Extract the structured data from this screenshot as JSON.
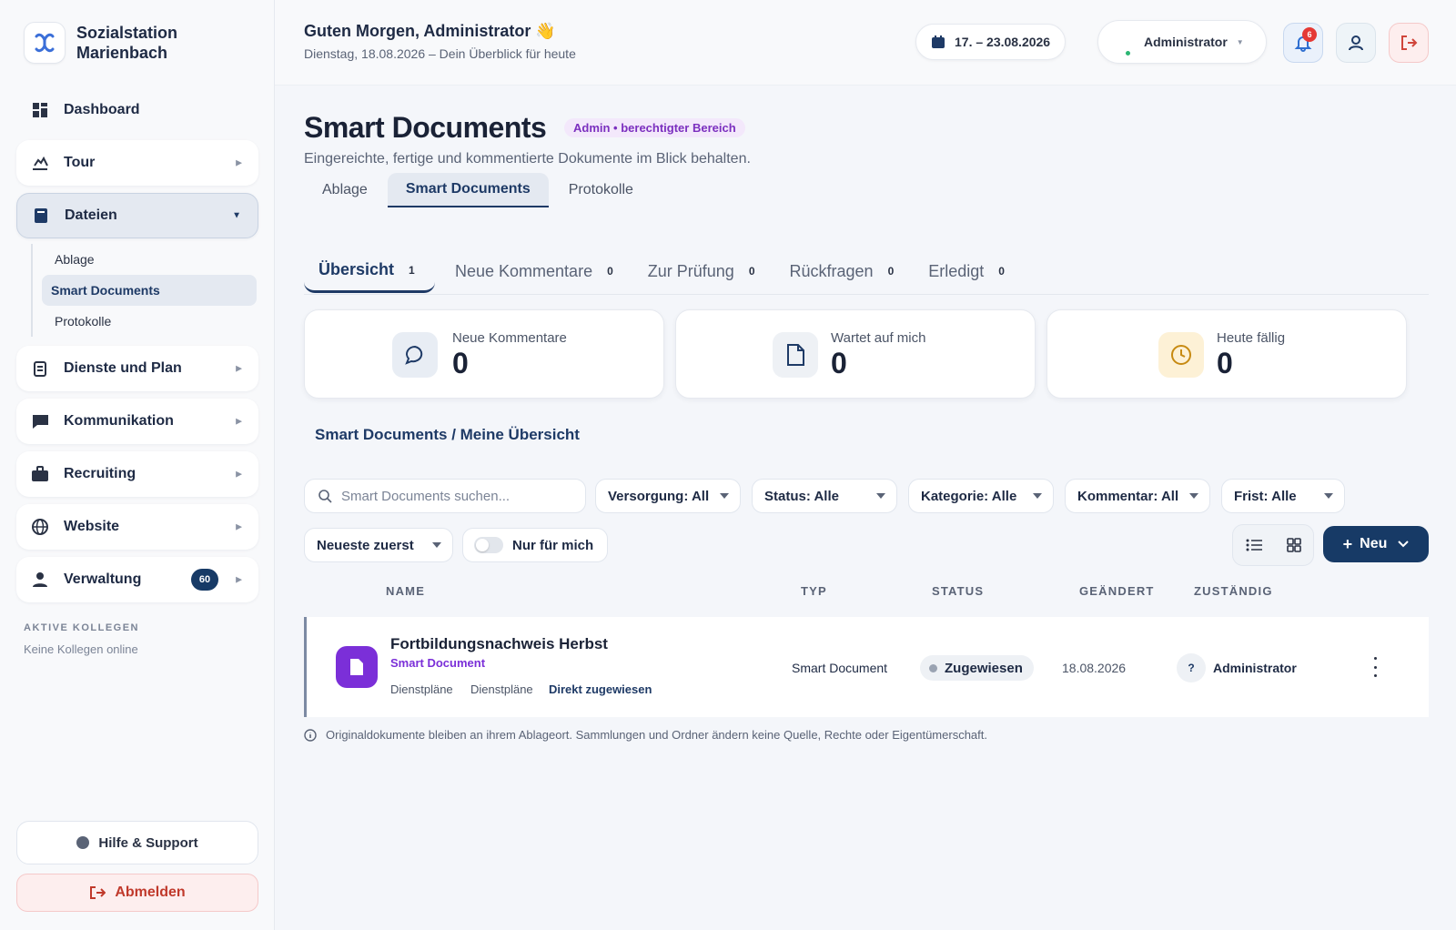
{
  "brand": {
    "line1": "Sozialstation",
    "line2": "Marienbach"
  },
  "sidebar": {
    "items": [
      {
        "label": "Dashboard",
        "icon": "dashboard-icon"
      },
      {
        "label": "Tour",
        "icon": "tour-icon"
      },
      {
        "label": "Dateien",
        "icon": "folder-icon"
      },
      {
        "label": "Dienste und Plan",
        "icon": "schedule-icon"
      },
      {
        "label": "Kommunikation",
        "icon": "chat-icon"
      },
      {
        "label": "Recruiting",
        "icon": "briefcase-icon"
      },
      {
        "label": "Website",
        "icon": "globe-icon"
      },
      {
        "label": "Verwaltung",
        "icon": "person-icon",
        "badge": "60"
      }
    ],
    "subitems": [
      "Ablage",
      "Smart Documents",
      "Protokolle"
    ],
    "colleagues_title": "AKTIVE KOLLEGEN",
    "colleagues_text": "Keine Kollegen online",
    "help": "Hilfe & Support",
    "logout": "Abmelden"
  },
  "header": {
    "greeting": "Guten Morgen, Administrator 👋",
    "subtitle": "Dienstag, 18.08.2026 – Dein Überblick für heute",
    "date_range": "17. – 23.08.2026",
    "user": "Administrator",
    "notifications": "6"
  },
  "page": {
    "title": "Smart Documents",
    "pill": "Admin • berechtigter Bereich",
    "subtitle": "Eingereichte, fertige und kommentierte Dokumente im Blick behalten.",
    "tabs": [
      "Ablage",
      "Smart Documents",
      "Protokolle"
    ]
  },
  "subtabs": [
    {
      "label": "Übersicht",
      "count": "1"
    },
    {
      "label": "Neue Kommentare",
      "count": "0"
    },
    {
      "label": "Zur Prüfung",
      "count": "0"
    },
    {
      "label": "Rückfragen",
      "count": "0"
    },
    {
      "label": "Erledigt",
      "count": "0"
    }
  ],
  "stats": [
    {
      "label": "Neue Kommentare",
      "value": "0",
      "icon": "comment-icon"
    },
    {
      "label": "Wartet auf mich",
      "value": "0",
      "icon": "document-icon"
    },
    {
      "label": "Heute fällig",
      "value": "0",
      "icon": "clock-icon"
    }
  ],
  "section_title": "Smart Documents / Meine Übersicht",
  "filters": {
    "search_placeholder": "Smart Documents suchen...",
    "versorgung": "Versorgung: All",
    "status": "Status: Alle",
    "kategorie": "Kategorie: Alle",
    "kommentar": "Kommentar: All",
    "frist": "Frist: Alle",
    "sort": "Neueste zuerst",
    "only_me": "Nur für mich",
    "new_button": "Neu"
  },
  "table": {
    "headers": [
      "NAME",
      "TYP",
      "STATUS",
      "GEÄNDERT",
      "ZUSTÄNDIG"
    ],
    "rows": [
      {
        "name": "Fortbildungsnachweis Herbst",
        "type_label": "Smart Document",
        "tags": [
          "Dienstpläne",
          "Dienstpläne",
          "Direkt zugewiesen"
        ],
        "type": "Smart Document",
        "status": "Zugewiesen",
        "changed": "18.08.2026",
        "assignee_initial": "?",
        "assignee": "Administrator"
      }
    ]
  },
  "footnote": "Originaldokumente bleiben an ihrem Ablageort. Sammlungen und Ordner ändern keine Quelle, Rechte oder Eigentümerschaft."
}
